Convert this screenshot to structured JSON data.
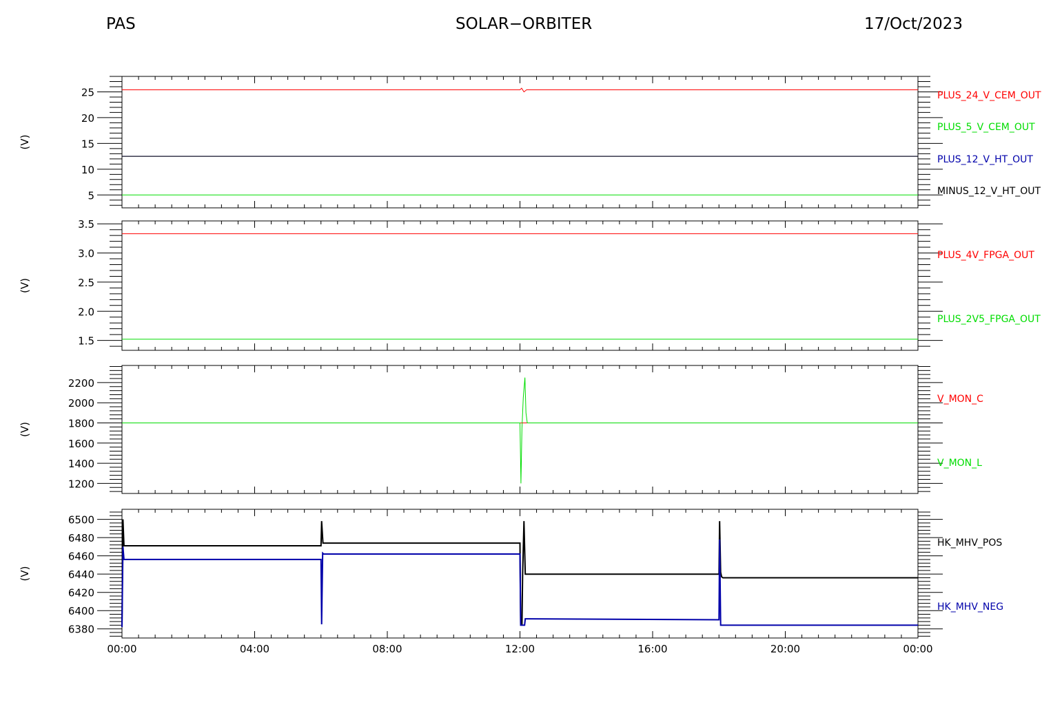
{
  "header": {
    "left": "PAS",
    "center": "SOLAR−ORBITER",
    "right": "17/Oct/2023"
  },
  "chart_data": [
    {
      "type": "line",
      "ylabel": "(V)",
      "ylim": [
        2.5,
        28.0
      ],
      "yticks": [
        5,
        10,
        15,
        20,
        25
      ],
      "ytick_labels": [
        "5",
        "10",
        "15",
        "20",
        "25"
      ],
      "series": [
        {
          "name": "PLUS_24_V_CEM_OUT",
          "color": "#ff0000",
          "x": [
            0,
            12.0,
            12.05,
            12.12,
            12.2,
            24
          ],
          "y": [
            25.4,
            25.4,
            25.7,
            25.0,
            25.4,
            25.4
          ]
        },
        {
          "name": "PLUS_5_V_CEM_OUT",
          "color": "#00dd00",
          "x": [
            0,
            24
          ],
          "y": [
            5.0,
            5.0
          ]
        },
        {
          "name": "PLUS_12_V_HT_OUT",
          "color": "#0000aa",
          "x": [
            0,
            24
          ],
          "y": [
            12.5,
            12.5
          ]
        },
        {
          "name": "MINUS_12_V_HT_OUT",
          "color": "#000000",
          "x": [
            0,
            24
          ],
          "y": [
            12.5,
            12.5
          ]
        }
      ]
    },
    {
      "type": "line",
      "ylabel": "(V)",
      "ylim": [
        1.33,
        3.55
      ],
      "yticks": [
        1.5,
        2.0,
        2.5,
        3.0,
        3.5
      ],
      "ytick_labels": [
        "1.5",
        "2.0",
        "2.5",
        "3.0",
        "3.5"
      ],
      "series": [
        {
          "name": "PLUS_4V_FPGA_OUT",
          "color": "#ff0000",
          "x": [
            0,
            24
          ],
          "y": [
            3.33,
            3.33
          ]
        },
        {
          "name": "PLUS_2V5_FPGA_OUT",
          "color": "#00dd00",
          "x": [
            0,
            24
          ],
          "y": [
            1.52,
            1.52
          ]
        }
      ]
    },
    {
      "type": "line",
      "ylabel": "(V)",
      "ylim": [
        1100,
        2370
      ],
      "yticks": [
        1200,
        1400,
        1600,
        1800,
        2000,
        2200
      ],
      "ytick_labels": [
        "1200",
        "1400",
        "1600",
        "1800",
        "2000",
        "2200"
      ],
      "series": [
        {
          "name": "V_MON_C",
          "color": "#ff0000",
          "x": [
            0,
            24
          ],
          "y": [
            1800,
            1800
          ]
        },
        {
          "name": "V_MON_L",
          "color": "#00dd00",
          "x": [
            0,
            12.0,
            12.03,
            12.06,
            12.1,
            12.15,
            12.18,
            12.22,
            24
          ],
          "y": [
            1800,
            1800,
            1200,
            1750,
            2050,
            2250,
            1900,
            1800,
            1800
          ]
        }
      ]
    },
    {
      "type": "line",
      "ylabel": "(V)",
      "ylim": [
        6370,
        6511
      ],
      "yticks": [
        6380,
        6400,
        6420,
        6440,
        6460,
        6480,
        6500
      ],
      "ytick_labels": [
        "6380",
        "6400",
        "6420",
        "6440",
        "6460",
        "6480",
        "6500"
      ],
      "xlim": [
        0,
        24
      ],
      "xticks": [
        0,
        4,
        8,
        12,
        16,
        20,
        24
      ],
      "xtick_labels": [
        "00:00",
        "04:00",
        "08:00",
        "12:00",
        "16:00",
        "20:00",
        "00:00"
      ],
      "series": [
        {
          "name": "HK_MHV_POS",
          "color": "#000000",
          "x": [
            0,
            0.03,
            0.06,
            0.1,
            6.0,
            6.02,
            6.06,
            6.1,
            12.0,
            12.02,
            12.06,
            12.08,
            12.12,
            12.16,
            12.2,
            18.0,
            18.02,
            18.05,
            18.08,
            18.12,
            24
          ],
          "y": [
            6385,
            6500,
            6471,
            6471,
            6471,
            6498,
            6474,
            6474,
            6474,
            6385,
            6385,
            6437,
            6498,
            6440,
            6440,
            6440,
            6498,
            6442,
            6437,
            6436,
            6436
          ]
        },
        {
          "name": "HK_MHV_NEG",
          "color": "#0000aa",
          "x": [
            0,
            0.03,
            0.06,
            0.1,
            6.0,
            6.02,
            6.05,
            6.08,
            6.12,
            12.0,
            12.02,
            12.14,
            12.16,
            12.2,
            18.0,
            18.02,
            18.05,
            18.08,
            24
          ],
          "y": [
            6382,
            6470,
            6456,
            6456,
            6456,
            6385,
            6463,
            6462,
            6462,
            6462,
            6384,
            6384,
            6391,
            6391,
            6390,
            6478,
            6384,
            6384,
            6384
          ]
        }
      ]
    }
  ]
}
